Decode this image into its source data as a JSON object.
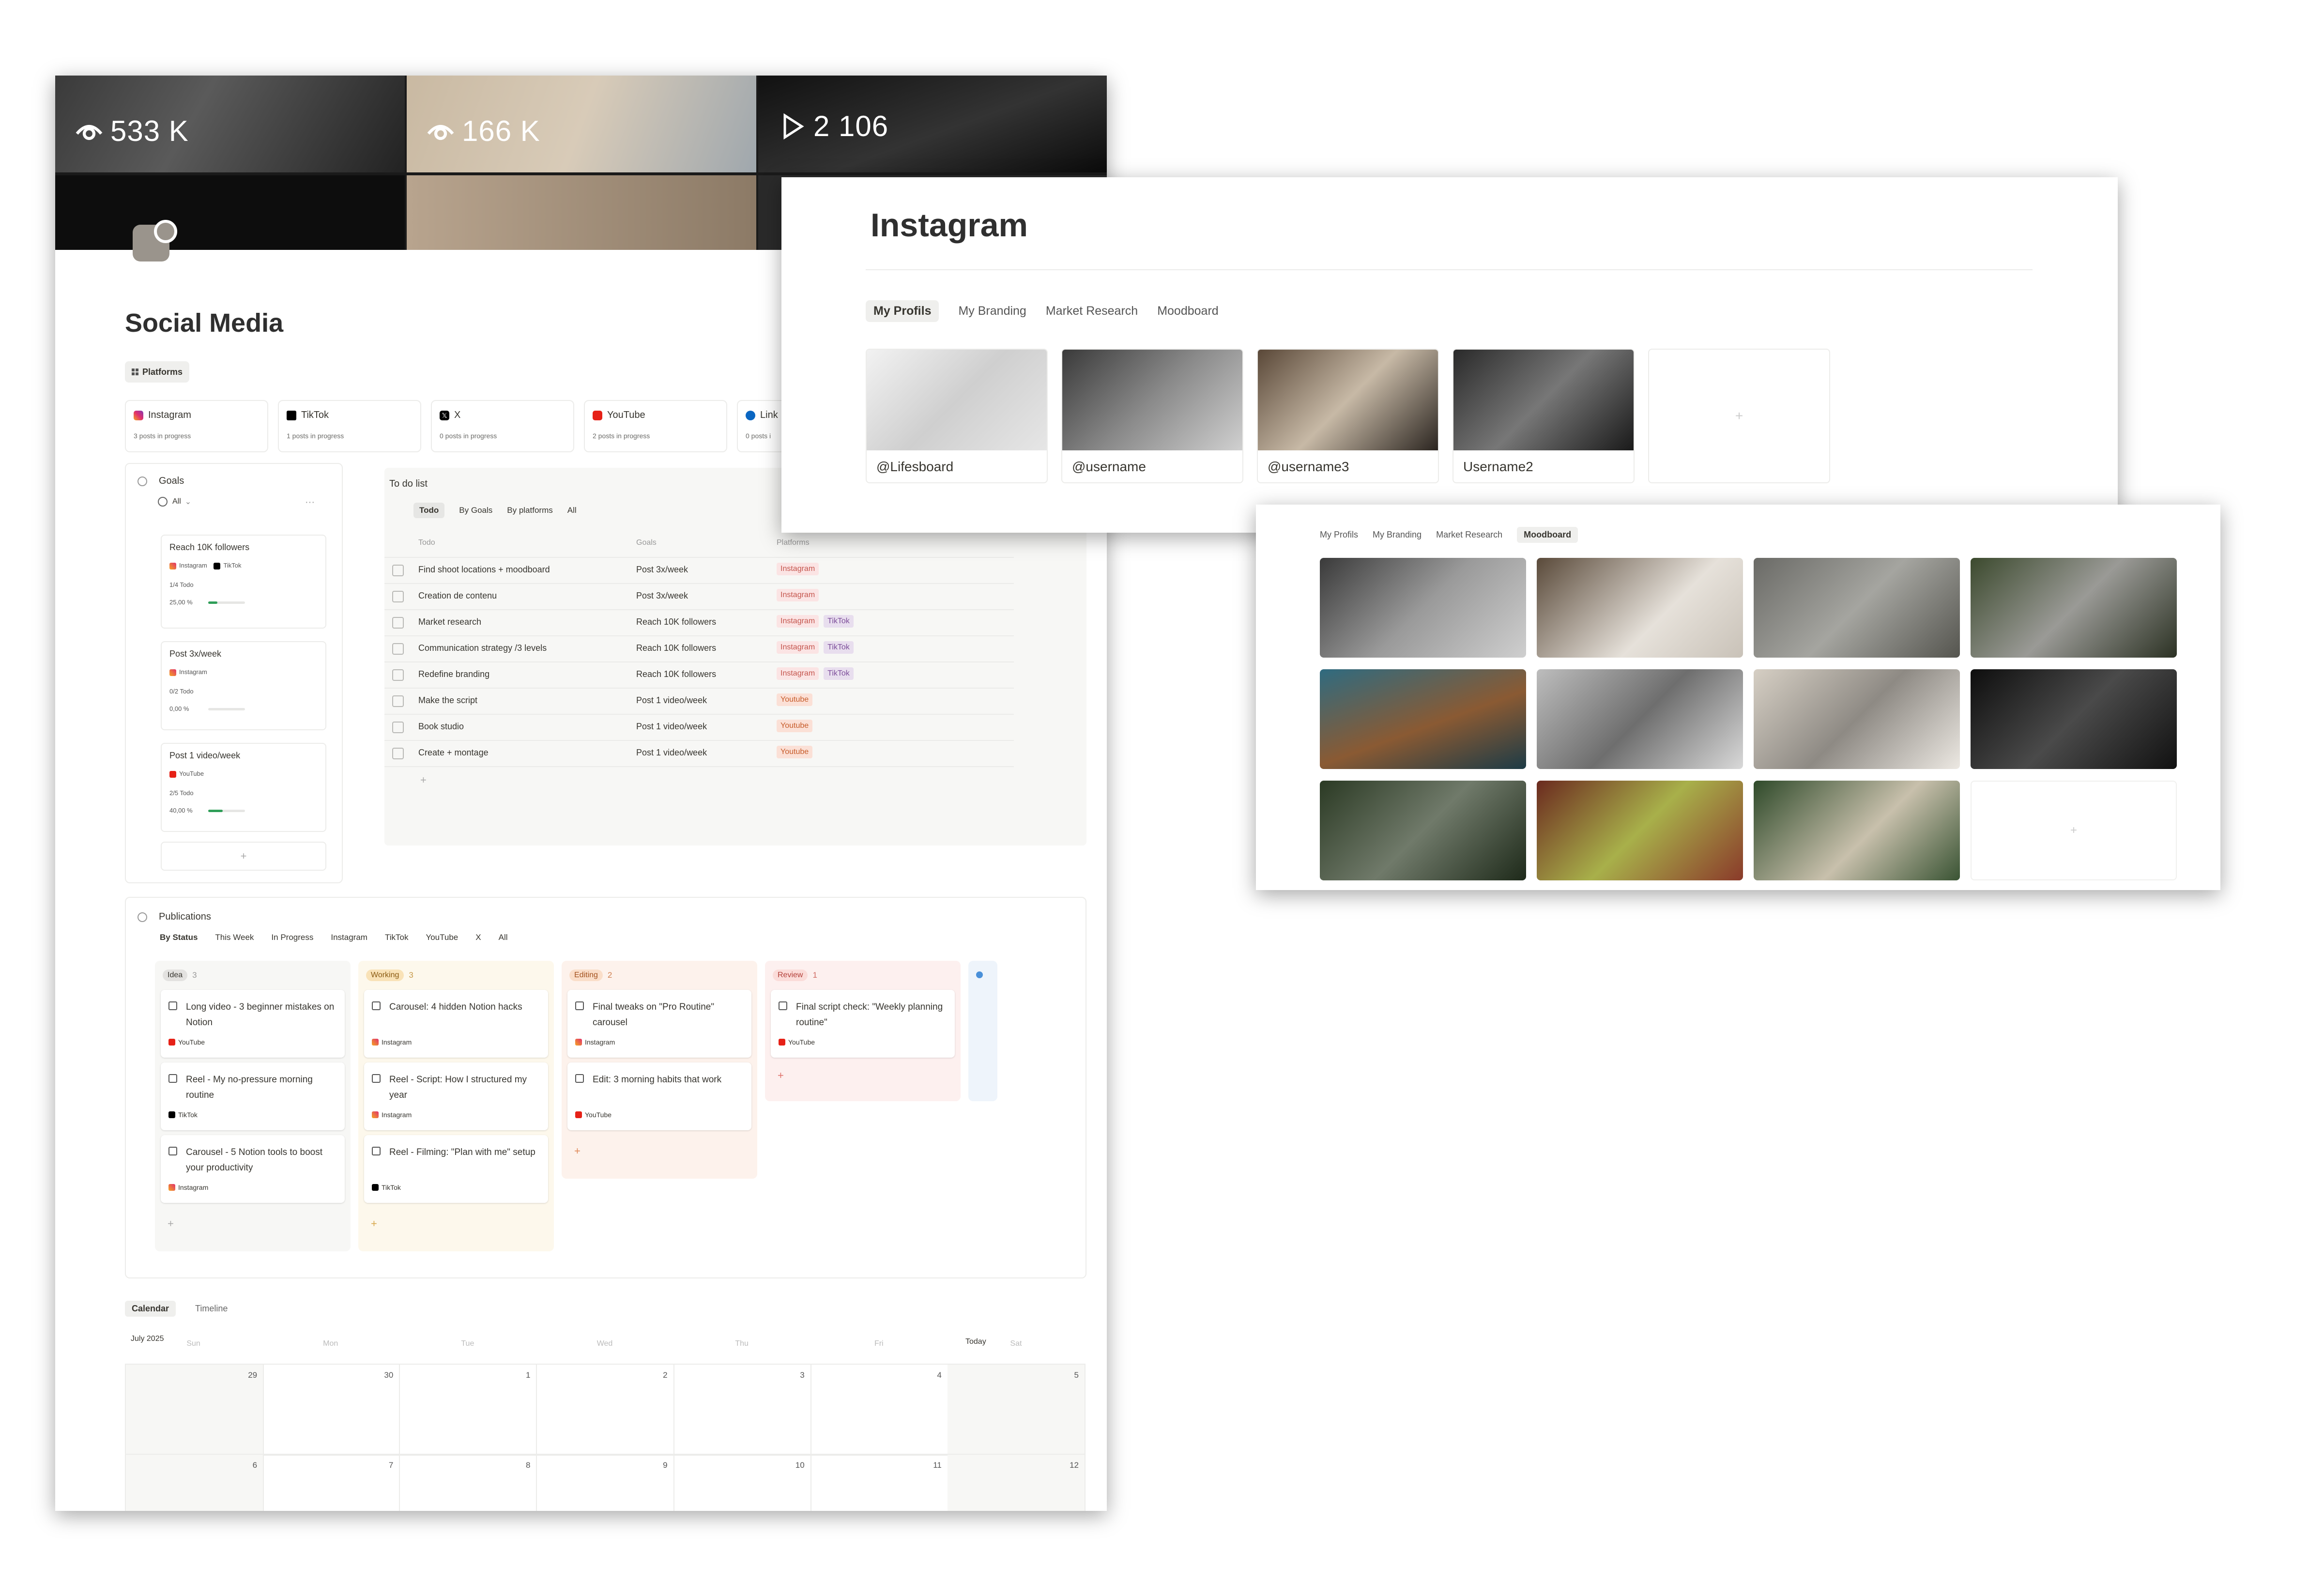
{
  "cover": {
    "stats": [
      {
        "icon": "eye-icon",
        "value": "533 K"
      },
      {
        "icon": "eye-icon",
        "value": "166 K"
      },
      {
        "icon": "play-icon",
        "value": "2 106"
      }
    ]
  },
  "page": {
    "title": "Social Media",
    "platforms_tab": "Platforms"
  },
  "platforms": [
    {
      "name": "Instagram",
      "icon": "instagram-icon",
      "sub": "3 posts in progress"
    },
    {
      "name": "TikTok",
      "icon": "tiktok-icon",
      "sub": "1 posts in progress"
    },
    {
      "name": "X",
      "icon": "x-icon",
      "sub": "0 posts in progress"
    },
    {
      "name": "YouTube",
      "icon": "youtube-icon",
      "sub": "2 posts in progress"
    },
    {
      "name": "Link",
      "icon": "linkedin-icon",
      "sub": "0 posts i"
    }
  ],
  "goals": {
    "title": "Goals",
    "filter": "All",
    "add": "+",
    "items": [
      {
        "title": "Reach 10K followers",
        "platforms": [
          "Instagram",
          "TikTok"
        ],
        "todo": "1/4 Todo",
        "progress": "25,00 %",
        "progress_value": 0.25
      },
      {
        "title": "Post 3x/week",
        "platforms": [
          "Instagram"
        ],
        "todo": "0/2 Todo",
        "progress": "0,00 %",
        "progress_value": 0
      },
      {
        "title": "Post 1 video/week",
        "platforms": [
          "YouTube"
        ],
        "todo": "2/5 Todo",
        "progress": "40,00 %",
        "progress_value": 0.4
      }
    ]
  },
  "todo": {
    "title": "To do list",
    "tabs": [
      "Todo",
      "By Goals",
      "By platforms",
      "All"
    ],
    "columns": [
      "Todo",
      "Goals",
      "Platforms"
    ],
    "rows": [
      {
        "task": "Find shoot locations + moodboard",
        "goal": "Post 3x/week",
        "platforms": [
          "Instagram"
        ]
      },
      {
        "task": "Creation de contenu",
        "goal": "Post 3x/week",
        "platforms": [
          "Instagram"
        ]
      },
      {
        "task": "Market research",
        "goal": "Reach 10K followers",
        "platforms": [
          "Instagram",
          "TikTok"
        ]
      },
      {
        "task": "Communication strategy /3 levels",
        "goal": "Reach 10K followers",
        "platforms": [
          "Instagram",
          "TikTok"
        ]
      },
      {
        "task": "Redefine branding",
        "goal": "Reach 10K followers",
        "platforms": [
          "Instagram",
          "TikTok"
        ]
      },
      {
        "task": "Make the script",
        "goal": "Post 1 video/week",
        "platforms": [
          "Youtube"
        ]
      },
      {
        "task": "Book studio",
        "goal": "Post 1 video/week",
        "platforms": [
          "Youtube"
        ]
      },
      {
        "task": "Create + montage",
        "goal": "Post 1 video/week",
        "platforms": [
          "Youtube"
        ]
      }
    ],
    "add": "+"
  },
  "publications": {
    "title": "Publications",
    "tabs": [
      "By Status",
      "This Week",
      "In Progress",
      "Instagram",
      "TikTok",
      "YouTube",
      "X",
      "All"
    ],
    "columns": [
      {
        "status": "Idea",
        "count": "3",
        "bg": "#f7f7f5",
        "badge_bg": "#e3e2e0",
        "badge_fg": "#37352f",
        "cards": [
          {
            "title": "Long video - 3 beginner mistakes on Notion",
            "platform": "YouTube"
          },
          {
            "title": "Reel - My no-pressure morning routine",
            "platform": "TikTok"
          },
          {
            "title": "Carousel - 5 Notion tools to boost your productivity",
            "platform": "Instagram"
          }
        ]
      },
      {
        "status": "Working",
        "count": "3",
        "bg": "#fdf8ec",
        "badge_bg": "#f9e2b7",
        "badge_fg": "#8a5a12",
        "cards": [
          {
            "title": "Carousel: 4 hidden Notion hacks",
            "platform": "Instagram"
          },
          {
            "title": "Reel - Script: How I structured my year",
            "platform": "Instagram"
          },
          {
            "title": "Reel - Filming: \"Plan with me\" setup",
            "platform": "TikTok"
          }
        ]
      },
      {
        "status": "Editing",
        "count": "2",
        "bg": "#fdf2ec",
        "badge_bg": "#fadec9",
        "badge_fg": "#a3511e",
        "cards": [
          {
            "title": "Final tweaks on \"Pro Routine\" carousel",
            "platform": "Instagram"
          },
          {
            "title": "Edit: 3 morning habits that work",
            "platform": "YouTube"
          }
        ]
      },
      {
        "status": "Review",
        "count": "1",
        "bg": "#fdf0ef",
        "badge_bg": "#fbdcd9",
        "badge_fg": "#b3403a",
        "cards": [
          {
            "title": "Final script check: \"Weekly planning routine\"",
            "platform": "YouTube"
          }
        ]
      }
    ],
    "add": "+"
  },
  "calendar": {
    "tabs": [
      "Calendar",
      "Timeline"
    ],
    "month": "July 2025",
    "today": "Today",
    "weekdays": [
      "Sun",
      "Mon",
      "Tue",
      "Wed",
      "Thu",
      "Fri",
      "Sat"
    ],
    "weeks": [
      [
        "29",
        "30",
        "1",
        "2",
        "3",
        "4",
        "5"
      ],
      [
        "6",
        "7",
        "8",
        "9",
        "10",
        "11",
        "12"
      ]
    ]
  },
  "instagram": {
    "title": "Instagram",
    "tabs": [
      "My Profils",
      "My Branding",
      "Market Research",
      "Moodboard"
    ],
    "profiles": [
      "@Lifesboard",
      "@username",
      "@username3",
      "Username2"
    ],
    "add": "+"
  },
  "moodboard": {
    "tabs": [
      "My Profils",
      "My Branding",
      "Market Research",
      "Moodboard"
    ],
    "add": "+"
  }
}
